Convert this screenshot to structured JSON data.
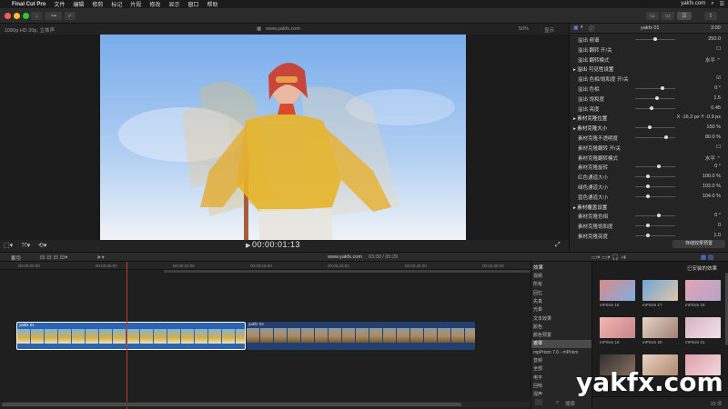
{
  "menubar": {
    "app_name": "Final Cut Pro",
    "items": [
      "文件",
      "编辑",
      "修剪",
      "标记",
      "片段",
      "修改",
      "显示",
      "窗口",
      "帮助"
    ],
    "site": "yakfx.com"
  },
  "viewer": {
    "format": "1080p HD 30p, 立体声",
    "project": "www.yakfx.com",
    "zoom": "50%",
    "display": "显示",
    "timecode": "00:00:01:13"
  },
  "inspector": {
    "title": "yakfx 01",
    "time": "3:00",
    "rows": [
      {
        "label": "溢出 频谱",
        "val": "250.0",
        "knob": 0.5
      },
      {
        "label": "溢出 翻转 开/关",
        "val": "☐"
      },
      {
        "label": "溢出 翻转模式",
        "val": "水平 ⌃"
      },
      {
        "label": "溢出 可见性设置",
        "val": "",
        "group": true
      },
      {
        "label": "溢出 色相/饱和度 开/关",
        "val": "☑"
      },
      {
        "label": "溢出 色相",
        "val": "0 °",
        "knob": 0.7
      },
      {
        "label": "溢出 饱和度",
        "val": "1.5",
        "knob": 0.55
      },
      {
        "label": "溢出 亮度",
        "val": "0.45",
        "knob": 0.4
      },
      {
        "label": "素材克隆位置",
        "val": "X  -16.2 px    Y  -0.9 px",
        "group": true
      },
      {
        "label": "素材克隆大小",
        "val": "150 %",
        "knob": 0.35,
        "group": true
      },
      {
        "label": "素材克隆不透明度",
        "val": "80.0 %",
        "knob": 0.8
      },
      {
        "label": "素材克隆翻转 开/关",
        "val": "☐"
      },
      {
        "label": "素材克隆翻转模式",
        "val": "水平 ⌃"
      },
      {
        "label": "素材克隆旋转",
        "val": "0 °",
        "knob": 0.6
      },
      {
        "label": "红色通道大小",
        "val": "100.0 %",
        "knob": 0.3
      },
      {
        "label": "绿色通道大小",
        "val": "102.0 %",
        "knob": 0.3
      },
      {
        "label": "蓝色通道大小",
        "val": "104.0 %",
        "knob": 0.3
      },
      {
        "label": "素材覆盖设置",
        "val": "",
        "group": true
      },
      {
        "label": "素材克隆色相",
        "val": "0 °",
        "knob": 0.6
      },
      {
        "label": "素材克隆饱和度",
        "val": "0",
        "knob": 0.3
      },
      {
        "label": "素材克隆亮度",
        "val": "1.0",
        "knob": 0.3
      }
    ],
    "save_button": "存储效果预置"
  },
  "timeline": {
    "index_label": "索引",
    "project": "www.yakfx.com",
    "duration": "03:00 / 05:29",
    "ruler": [
      "00:00:00:00",
      "00:00:05:00",
      "00:00:10:00",
      "00:00:15:00",
      "00:00:20:00",
      "00:00:25:00",
      "00:00:30:00"
    ],
    "clip1": "yakfx 01",
    "clip2": "yakfx 02"
  },
  "effects": {
    "header": "效果",
    "installed": "已安装的效果",
    "categories": [
      "视频",
      "所有",
      "回忆",
      "失真",
      "光晕",
      "文本效果",
      "颜色",
      "颜色预置",
      "遮罩",
      "mpPrism 7.6 - mPrism",
      "音频",
      "全部",
      "电平",
      "回响",
      "混声"
    ],
    "selected_index": 8,
    "cards": [
      "mPrism 16",
      "mPrism 17",
      "mPrism 18",
      "mPrism 19",
      "mPrism 20",
      "mPrism 21",
      "",
      "",
      ""
    ],
    "search": "搜索",
    "count": "93 项"
  },
  "watermark": "yakfx.com",
  "colors": {
    "accent": "#5b8cff",
    "clip_blue": "#2c63ad",
    "playhead": "#c0392b"
  }
}
